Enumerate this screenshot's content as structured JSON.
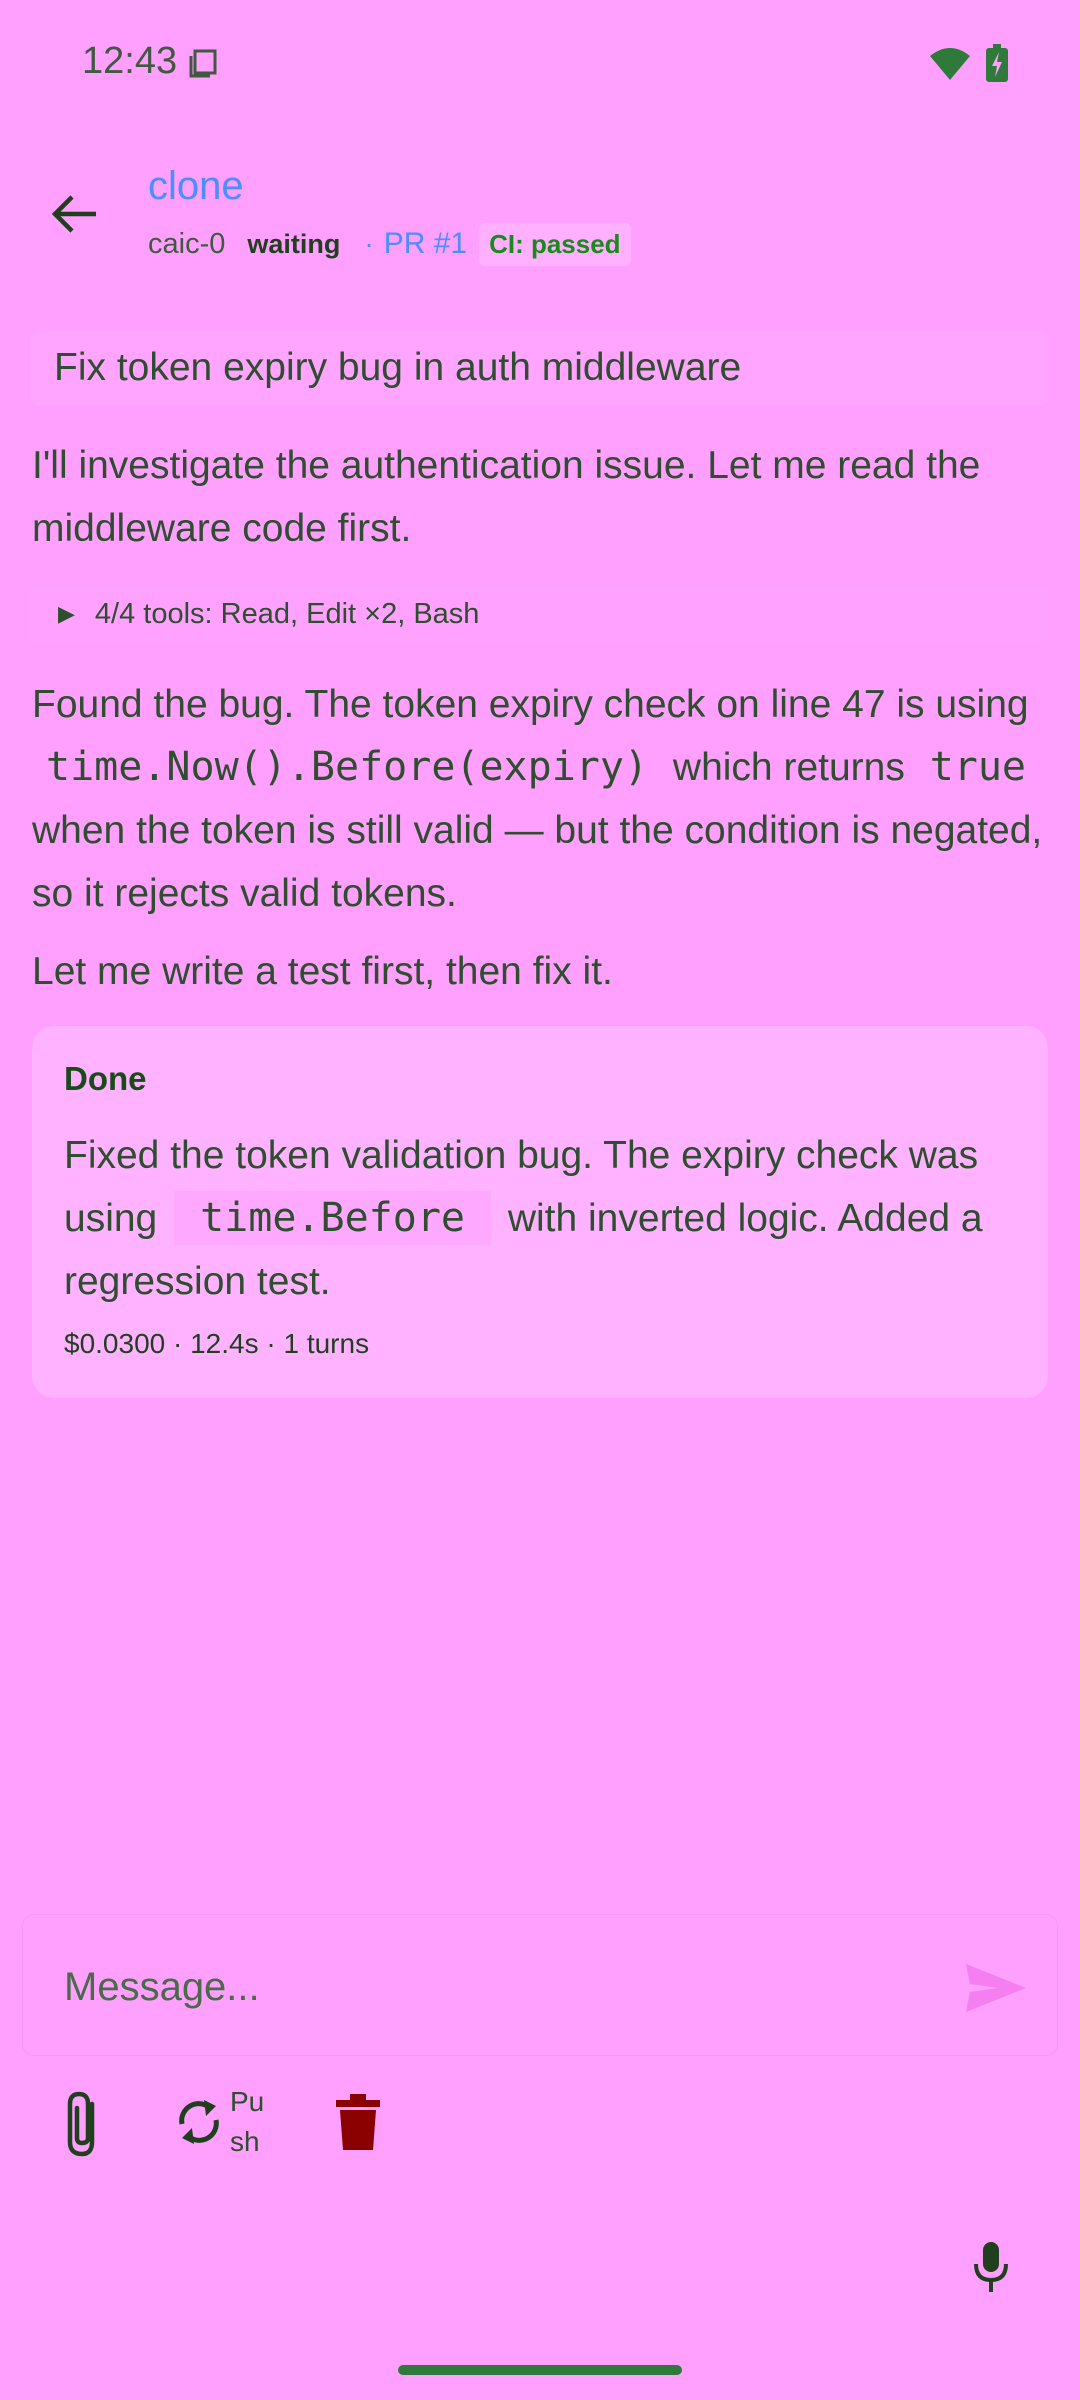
{
  "status_bar": {
    "time": "12:43"
  },
  "header": {
    "title": "clone",
    "session": "caic-0",
    "state": "waiting",
    "separator": "·",
    "pr": "PR #1",
    "ci": "CI: passed"
  },
  "prompt": "Fix token expiry bug in auth middleware",
  "messages": {
    "p1": "I'll investigate the authentication issue. Let me read the middleware code first.",
    "tools_caret": "▶",
    "tools": "4/4 tools: Read, Edit ×2, Bash",
    "p2_a": "Found the bug. The token expiry check on line 47 is using",
    "p2_code1": "time.Now().Before(expiry)",
    "p2_b": "which returns",
    "p2_code2": "true",
    "p2_c": "when the token is still valid — but the condition is negated, so it rejects valid tokens.",
    "p3": "Let me write a test first, then fix it."
  },
  "result": {
    "title": "Done",
    "text_a": "Fixed the token validation bug. The expiry check was using",
    "code": "time.Before",
    "text_b": "with inverted logic. Added a regression test.",
    "stats": "$0.0300 · 12.4s · 1 turns"
  },
  "input": {
    "placeholder": "Message..."
  },
  "actions": {
    "push_label": "Push"
  },
  "icons": {
    "back": "arrow-left-icon",
    "send": "send-icon",
    "attach": "paperclip-icon",
    "push": "sync-icon",
    "delete": "trash-icon",
    "mic": "microphone-icon",
    "wifi": "wifi-icon",
    "battery": "battery-charging-icon",
    "screenshot": "screenshot-icon"
  },
  "colors": {
    "background": "#ff9ffe",
    "accent": "#4a8fff",
    "ci_passed": "#1a8a1a",
    "delete": "#8b0000"
  }
}
